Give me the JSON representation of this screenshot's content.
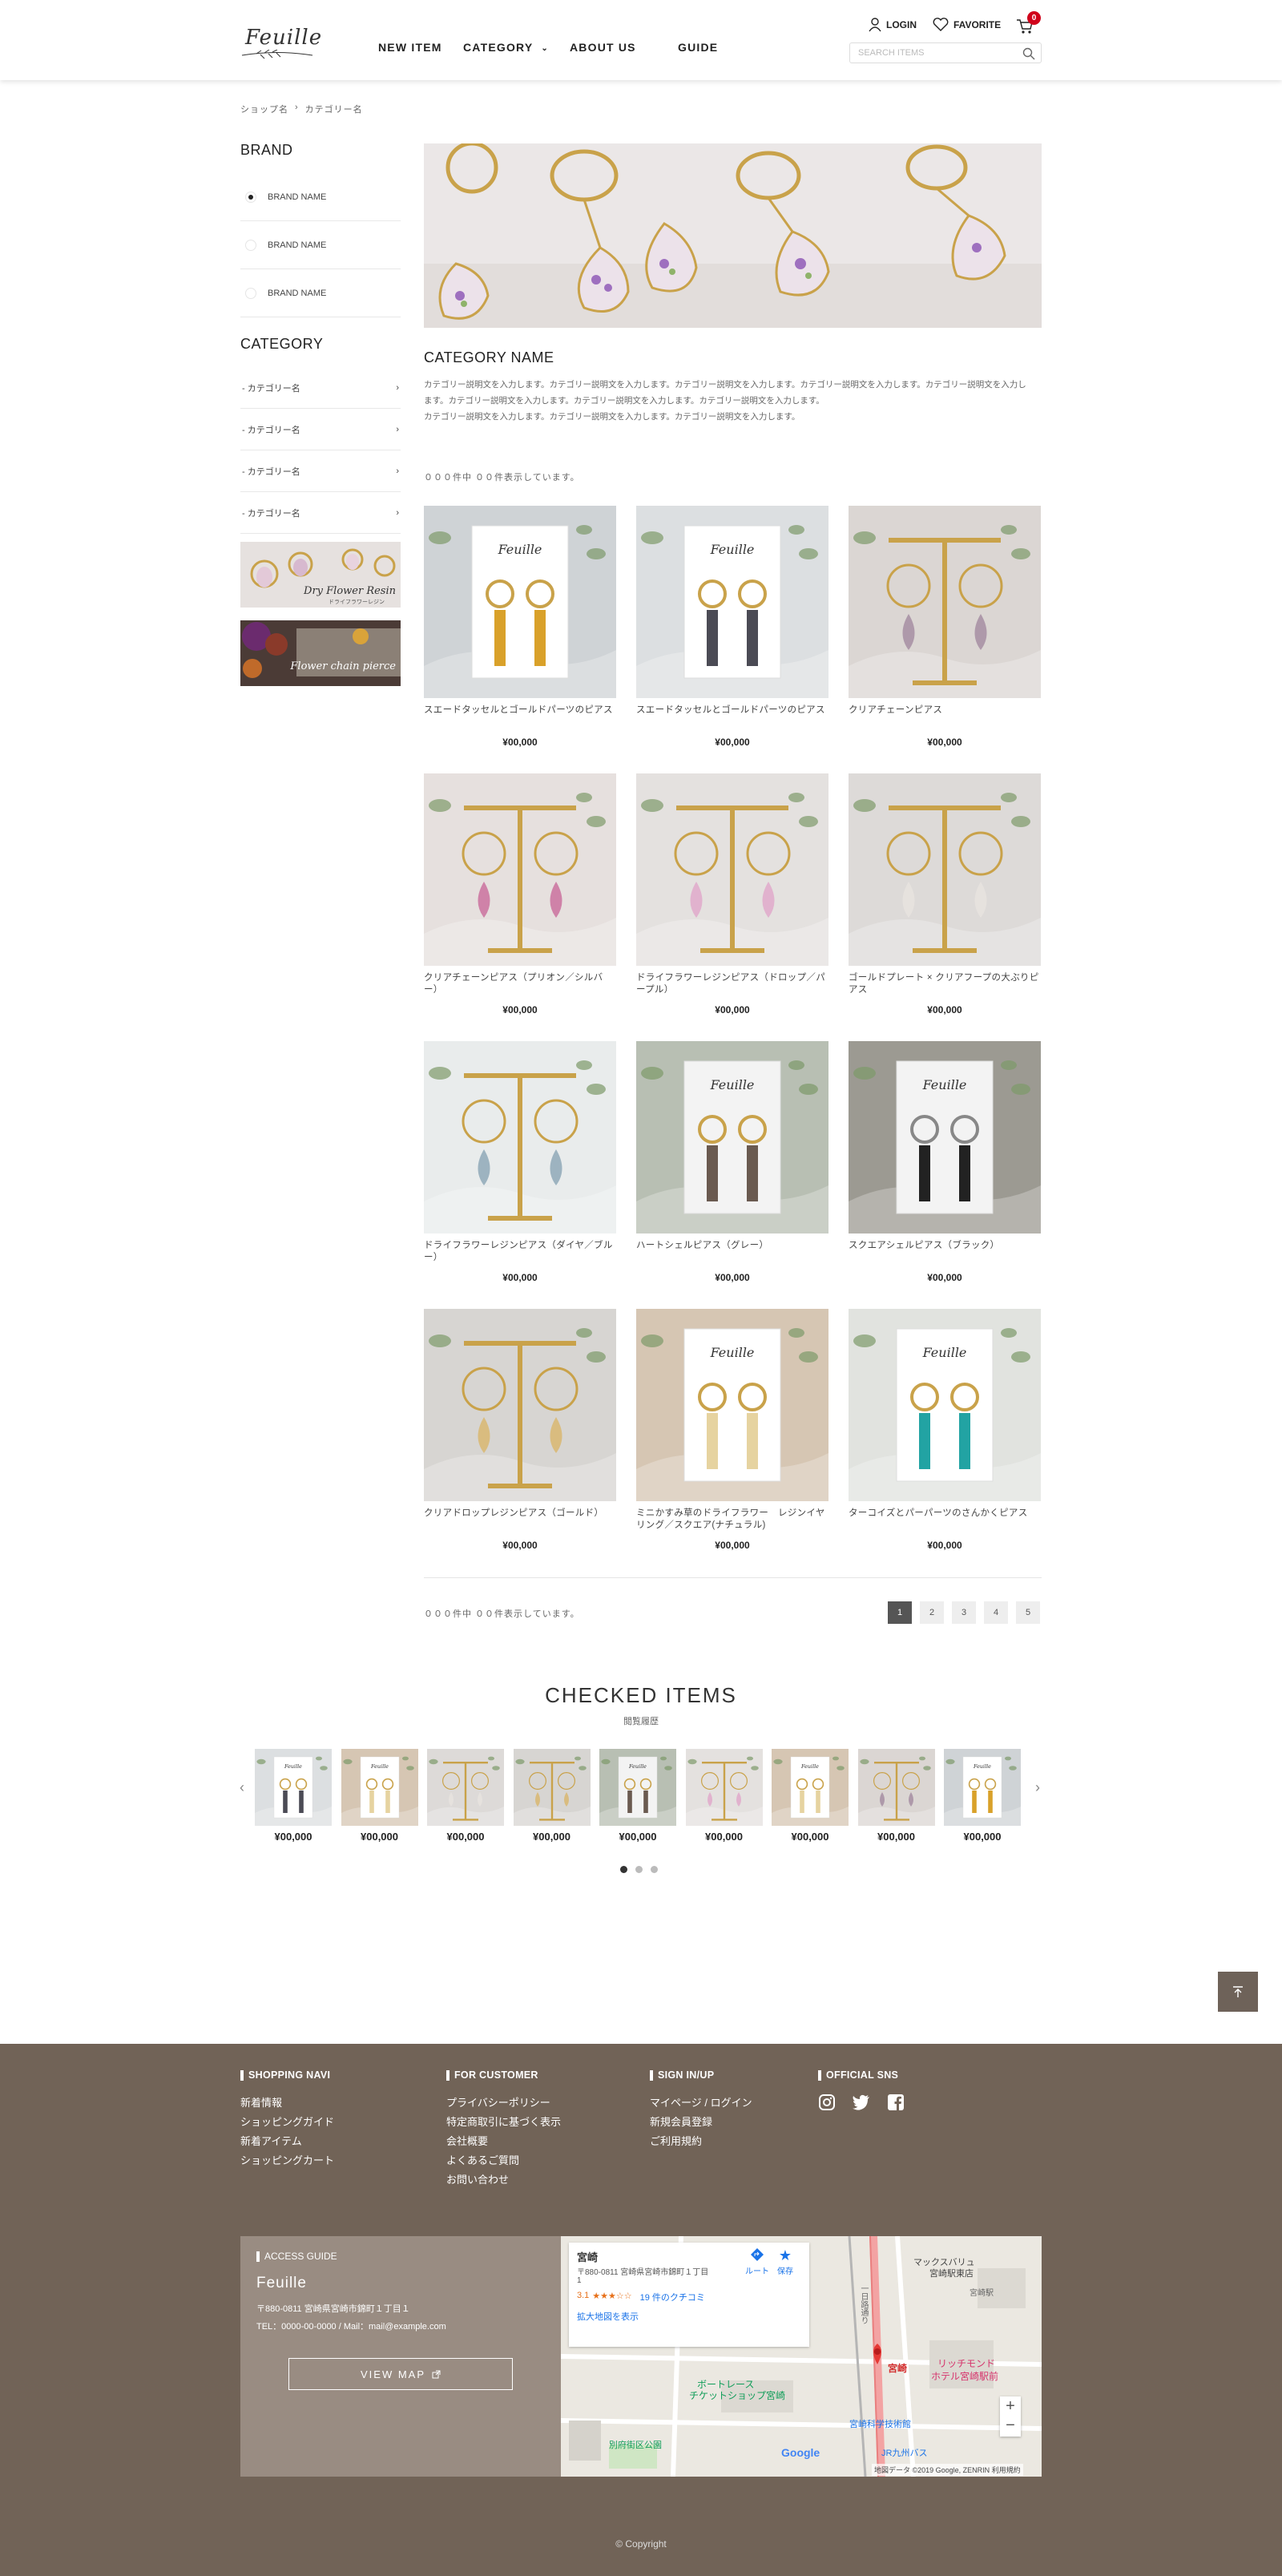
{
  "header": {
    "logo_text": "Feuille",
    "nav": [
      {
        "label": "NEW ITEM"
      },
      {
        "label": "CATEGORY",
        "caret": "⌄"
      },
      {
        "label": "ABOUT US"
      },
      {
        "label": "GUIDE"
      }
    ],
    "login_label": "LOGIN",
    "favorite_label": "FAVORITE",
    "cart_count": "0",
    "search_placeholder": "SEARCH ITEMS"
  },
  "breadcrumb": [
    "ショップ名",
    "›",
    "カテゴリー名"
  ],
  "sidebar": {
    "brand_title": "BRAND",
    "brands": [
      {
        "label": "BRAND NAME",
        "selected": true
      },
      {
        "label": "BRAND NAME",
        "selected": false
      },
      {
        "label": "BRAND NAME",
        "selected": false
      }
    ],
    "category_title": "CATEGORY",
    "categories": [
      {
        "label": "- カテゴリー名",
        "arrow": "›"
      },
      {
        "label": "- カテゴリー名",
        "arrow": "›"
      },
      {
        "label": "- カテゴリー名",
        "arrow": "›"
      },
      {
        "label": "- カテゴリー名",
        "arrow": "›"
      }
    ],
    "banners": [
      {
        "caption": "Dry Flower Resin",
        "sub": "ドライフラワーレジン"
      },
      {
        "caption": "Flower chain pierce",
        "sub": ""
      }
    ]
  },
  "main": {
    "category_name": "CATEGORY NAME",
    "description": [
      "カテゴリー説明文を入力します。カテゴリー説明文を入力します。カテゴリー説明文を入力します。カテゴリー説明文を入力します。カテゴリー説明文を入力し",
      "ます。カテゴリー説明文を入力します。カテゴリー説明文を入力します。カテゴリー説明文を入力します。",
      "カテゴリー説明文を入力します。カテゴリー説明文を入力します。カテゴリー説明文を入力します。"
    ],
    "count_text": "０００件中 ００件表示しています。",
    "products": [
      {
        "name": "スエードタッセルとゴールドパーツのピアス",
        "price": "¥00,000"
      },
      {
        "name": "スエードタッセルとゴールドパーツのピアス",
        "price": "¥00,000"
      },
      {
        "name": "クリアチェーンピアス",
        "price": "¥00,000"
      },
      {
        "name": "クリアチェーンピアス（プリオン／シルバー）",
        "price": "¥00,000"
      },
      {
        "name": "ドライフラワーレジンピアス（ドロップ／パープル）",
        "price": "¥00,000"
      },
      {
        "name": "ゴールドプレート × クリアフープの大ぶりピアス",
        "price": "¥00,000"
      },
      {
        "name": "ドライフラワーレジンピアス（ダイヤ／ブルー）",
        "price": "¥00,000"
      },
      {
        "name": "ハートシェルピアス（グレー）",
        "price": "¥00,000"
      },
      {
        "name": "スクエアシェルピアス（ブラック）",
        "price": "¥00,000"
      },
      {
        "name": "クリアドロップレジンピアス（ゴールド）",
        "price": "¥00,000"
      },
      {
        "name": "ミニかすみ草のドライフラワー　レジンイヤリング／スクエア(ナチュラル)",
        "price": "¥00,000"
      },
      {
        "name": "ターコイズとパーパーツのさんかくピアス",
        "price": "¥00,000"
      }
    ],
    "pages": [
      "1",
      "2",
      "3",
      "4",
      "5"
    ],
    "current_page": "1"
  },
  "checked": {
    "title": "CHECKED ITEMS",
    "subtitle": "閲覧履歴",
    "prev": "‹",
    "next": "›",
    "items": [
      {
        "price": "¥00,000"
      },
      {
        "price": "¥00,000"
      },
      {
        "price": "¥00,000"
      },
      {
        "price": "¥00,000"
      },
      {
        "price": "¥00,000"
      },
      {
        "price": "¥00,000"
      },
      {
        "price": "¥00,000"
      },
      {
        "price": "¥00,000"
      },
      {
        "price": "¥00,000"
      }
    ]
  },
  "footer": {
    "columns": [
      {
        "title": "SHOPPING NAVI",
        "links": [
          "新着情報",
          "ショッピングガイド",
          "新着アイテム",
          "ショッピングカート"
        ]
      },
      {
        "title": "FOR CUSTOMER",
        "links": [
          "プライバシーポリシー",
          "特定商取引に基づく表示",
          "会社概要",
          "よくあるご質問",
          "お問い合わせ"
        ]
      },
      {
        "title": "SIGN IN/UP",
        "links": [
          "マイページ / ログイン",
          "新規会員登録",
          "ご利用規約"
        ]
      },
      {
        "title": "OFFICIAL SNS",
        "links": []
      }
    ],
    "access": {
      "title": "ACCESS GUIDE",
      "name": "Feuille",
      "address": "〒880-0811 宮崎県宮崎市錦町１丁目１",
      "tel": "TEL：0000-00-0000 / Mail：mail@example.com",
      "button": "VIEW MAP"
    },
    "map": {
      "place": "宮崎",
      "address": "〒880-0811 宮崎県宮崎市錦町１丁目",
      "address2": "1",
      "rating": "3.1",
      "stars": "★★★☆☆",
      "reviews": "19 件のクチコミ",
      "route": "ルート",
      "save": "保存",
      "enlarge": "拡大地図を表示",
      "labels": [
        "マックスバリュ",
        "宮崎駅東店",
        "宮崎駅",
        "リッチモンド",
        "ホテル宮崎駅前",
        "宮崎",
        "ボートレース",
        "チケットショップ宮崎",
        "宮崎科学技術館",
        "JR九州バス",
        "別府街区公園",
        "一日路通り"
      ],
      "footer": "地図データ ©2019 Google, ZENRIN   利用規約",
      "brand": "Google"
    },
    "copyright": "© Copyright"
  },
  "colors": {
    "footer_bg": "#716357",
    "access_bg": "#998c82",
    "badge": "#d0021b",
    "pin": "#e53935"
  }
}
